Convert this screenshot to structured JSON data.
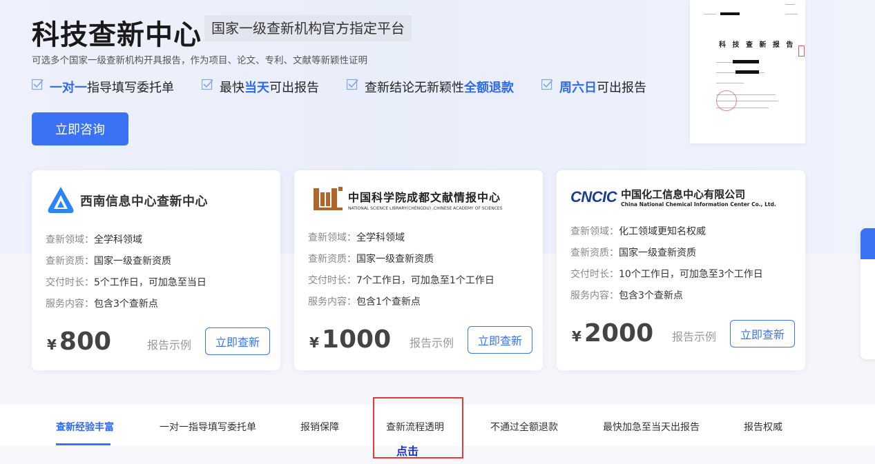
{
  "hero": {
    "title": "科技查新中心",
    "subtitle": "国家一级查新机构官方指定平台",
    "description": "可选多个国家一级查新机构开具报告，作为项目、论文、专利、文献等新颖性证明",
    "features": [
      {
        "highlight": "一对一",
        "text": "指导填写委托单"
      },
      {
        "prefix": "最快",
        "highlight": "当天",
        "text": "可出报告"
      },
      {
        "prefix": "查新结论无新颖性",
        "highlight": "全额退款",
        "text": ""
      },
      {
        "highlight": "周六日",
        "text": "可出报告"
      }
    ],
    "consult_button": "立即咨询",
    "report_preview_title": "科 技 查 新 报 告"
  },
  "cards": [
    {
      "org_name": "西南信息中心查新中心",
      "rows": [
        {
          "k": "查新领域：",
          "v": "全学科领域"
        },
        {
          "k": "查新资质：",
          "v": "国家一级查新资质"
        },
        {
          "k": "交付时长：",
          "v": "5个工作日，可加急至当日"
        },
        {
          "k": "服务内容：",
          "v": "包含3个查新点"
        }
      ],
      "currency": "¥",
      "price": "800",
      "sample": "报告示例",
      "button": "立即查新"
    },
    {
      "org_name_cn": "中国科学院成都文献情报中心",
      "org_name_en": "NATIONAL SCIENCE LIBRARY(CHENGDU) ,CHINESE ACADEMY OF SCIENCES",
      "rows": [
        {
          "k": "查新领域：",
          "v": "全学科领域"
        },
        {
          "k": "查新资质：",
          "v": "国家一级查新资质"
        },
        {
          "k": "交付时长：",
          "v": "7个工作日，可加急至1个工作日"
        },
        {
          "k": "服务内容：",
          "v": "包含1个查新点"
        }
      ],
      "currency": "¥",
      "price": "1000",
      "sample": "报告示例",
      "button": "立即查新"
    },
    {
      "logo_mark": "CNCIC",
      "org_name_cn": "中国化工信息中心有限公司",
      "org_name_en": "China National Chemical Information Center Co., Ltd.",
      "rows": [
        {
          "k": "查新领域：",
          "v": "化工领域更知名权威"
        },
        {
          "k": "查新资质：",
          "v": "国家一级查新资质"
        },
        {
          "k": "交付时长：",
          "v": "10个工作日，可加急至3个工作日"
        },
        {
          "k": "服务内容：",
          "v": "包含3个查新点"
        }
      ],
      "currency": "¥",
      "price": "2000",
      "sample": "报告示例",
      "button": "立即查新"
    }
  ],
  "tabs": [
    "查新经验丰富",
    "一对一指导填写委托单",
    "报销保障",
    "查新流程透明",
    "不通过全额退款",
    "最快加急至当天出报告",
    "报告权威"
  ],
  "active_tab": 0,
  "annotation_label": "点击",
  "colors": {
    "accent": "#3a72f4",
    "highlight_box": "#e53935"
  }
}
